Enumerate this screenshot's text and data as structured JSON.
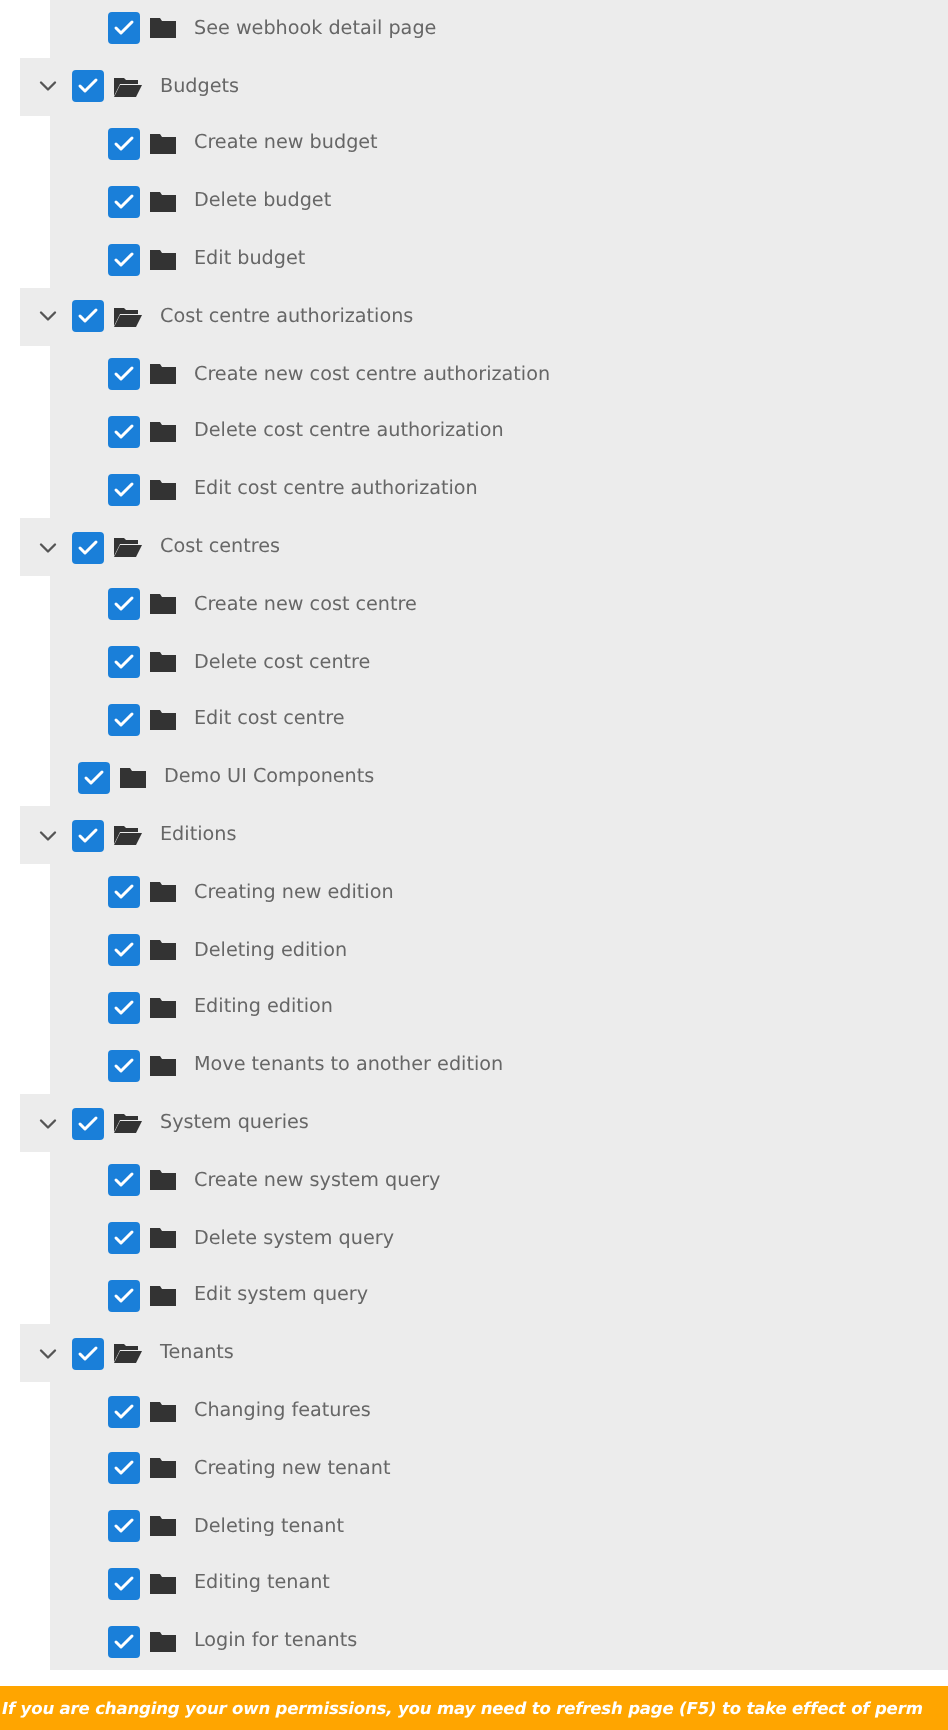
{
  "tree": [
    {
      "label": "See webhook detail page",
      "checked": true
    },
    {
      "label": "Budgets",
      "checked": true,
      "expanded": true,
      "children": [
        {
          "label": "Create new budget",
          "checked": true
        },
        {
          "label": "Delete budget",
          "checked": true
        },
        {
          "label": "Edit budget",
          "checked": true
        }
      ]
    },
    {
      "label": "Cost centre authorizations",
      "checked": true,
      "expanded": true,
      "children": [
        {
          "label": "Create new cost centre authorization",
          "checked": true
        },
        {
          "label": "Delete cost centre authorization",
          "checked": true
        },
        {
          "label": "Edit cost centre authorization",
          "checked": true
        }
      ]
    },
    {
      "label": "Cost centres",
      "checked": true,
      "expanded": true,
      "children": [
        {
          "label": "Create new cost centre",
          "checked": true
        },
        {
          "label": "Delete cost centre",
          "checked": true
        },
        {
          "label": "Edit cost centre",
          "checked": true
        }
      ]
    },
    {
      "label": "Demo UI Components",
      "checked": true
    },
    {
      "label": "Editions",
      "checked": true,
      "expanded": true,
      "children": [
        {
          "label": "Creating new edition",
          "checked": true
        },
        {
          "label": "Deleting edition",
          "checked": true
        },
        {
          "label": "Editing edition",
          "checked": true
        },
        {
          "label": "Move tenants to another edition",
          "checked": true
        }
      ]
    },
    {
      "label": "System queries",
      "checked": true,
      "expanded": true,
      "children": [
        {
          "label": "Create new system query",
          "checked": true
        },
        {
          "label": "Delete system query",
          "checked": true
        },
        {
          "label": "Edit system query",
          "checked": true
        }
      ]
    },
    {
      "label": "Tenants",
      "checked": true,
      "expanded": true,
      "children": [
        {
          "label": "Changing features",
          "checked": true
        },
        {
          "label": "Creating new tenant",
          "checked": true
        },
        {
          "label": "Deleting tenant",
          "checked": true
        },
        {
          "label": "Editing tenant",
          "checked": true
        },
        {
          "label": "Login for tenants",
          "checked": true
        }
      ]
    }
  ],
  "warning": "If you are changing your own permissions, you may need to refresh page (F5) to take effect of perm"
}
